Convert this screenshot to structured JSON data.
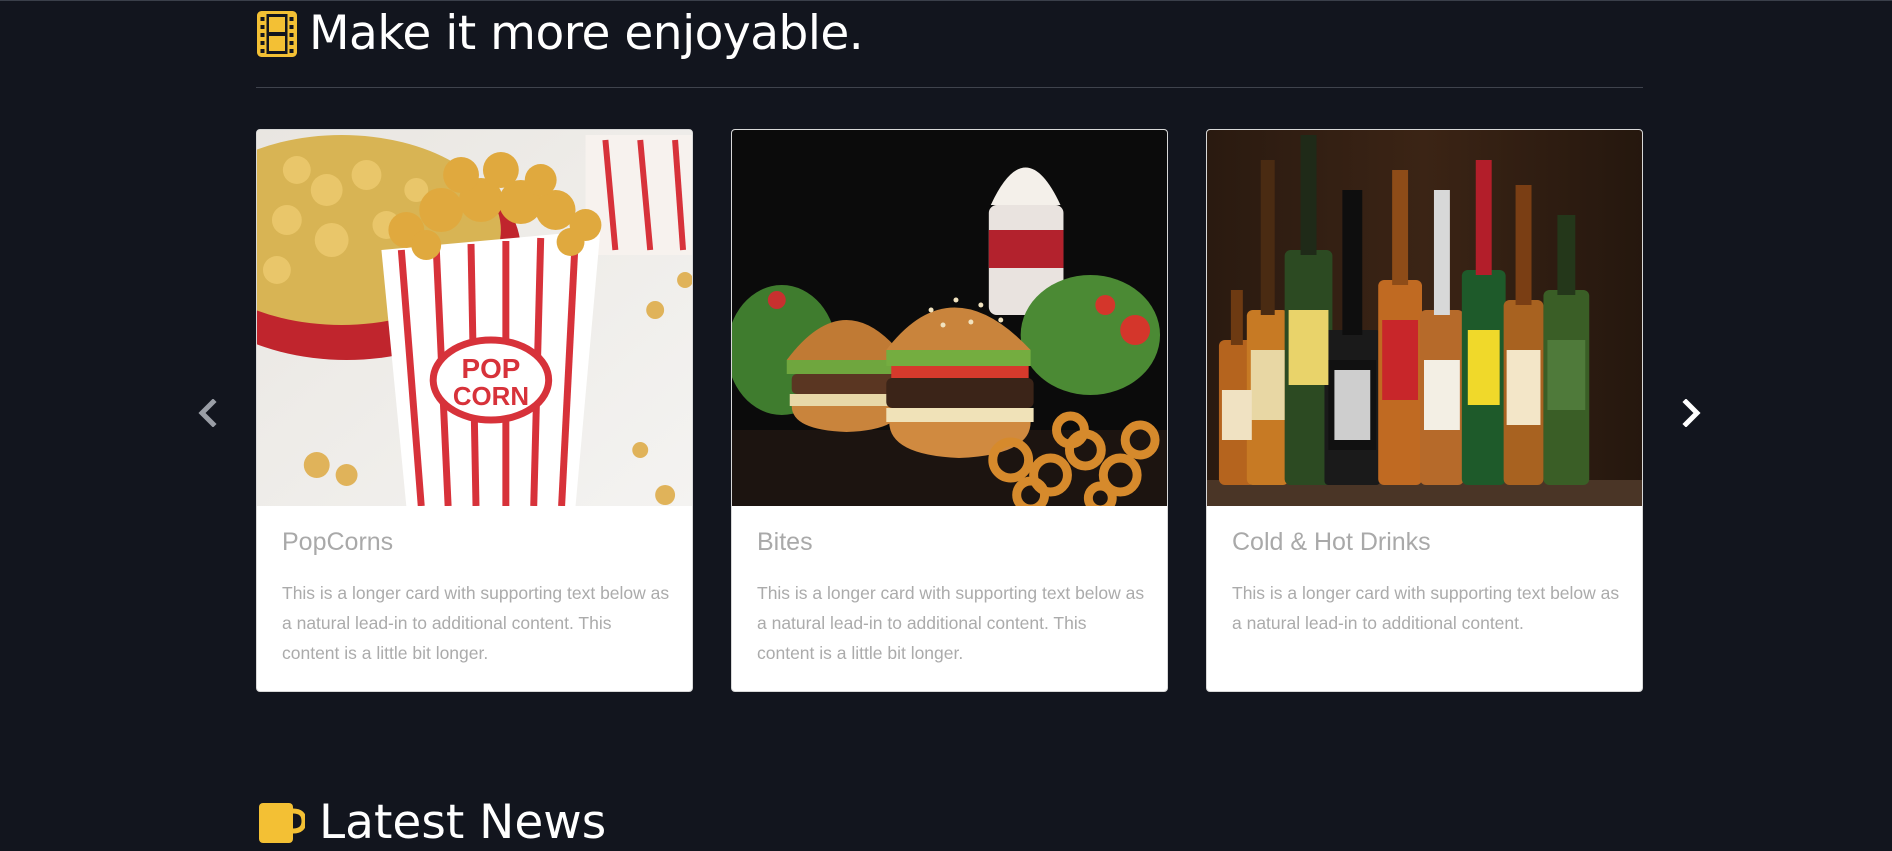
{
  "section": {
    "title": "Make it more enjoyable.",
    "icon": "film-icon"
  },
  "carousel": {
    "prev_icon": "chevron-left-icon",
    "next_icon": "chevron-right-icon",
    "cards": [
      {
        "title": "PopCorns",
        "text": "This is a longer card with supporting text below as a natural lead-in to additional content. This content is a little bit longer.",
        "image": "popcorn-image"
      },
      {
        "title": "Bites",
        "text": "This is a longer card with supporting text below as a natural lead-in to additional content. This content is a little bit longer.",
        "image": "burger-image"
      },
      {
        "title": "Cold & Hot Drinks",
        "text": "This is a longer card with supporting text below as a natural lead-in to additional content.",
        "image": "drinks-image"
      }
    ]
  },
  "news": {
    "title": "Latest News",
    "icon": "mug-icon"
  },
  "colors": {
    "background": "#12151e",
    "accent": "#f3c034",
    "card": "#ffffff",
    "muted_text": "#ababab"
  }
}
